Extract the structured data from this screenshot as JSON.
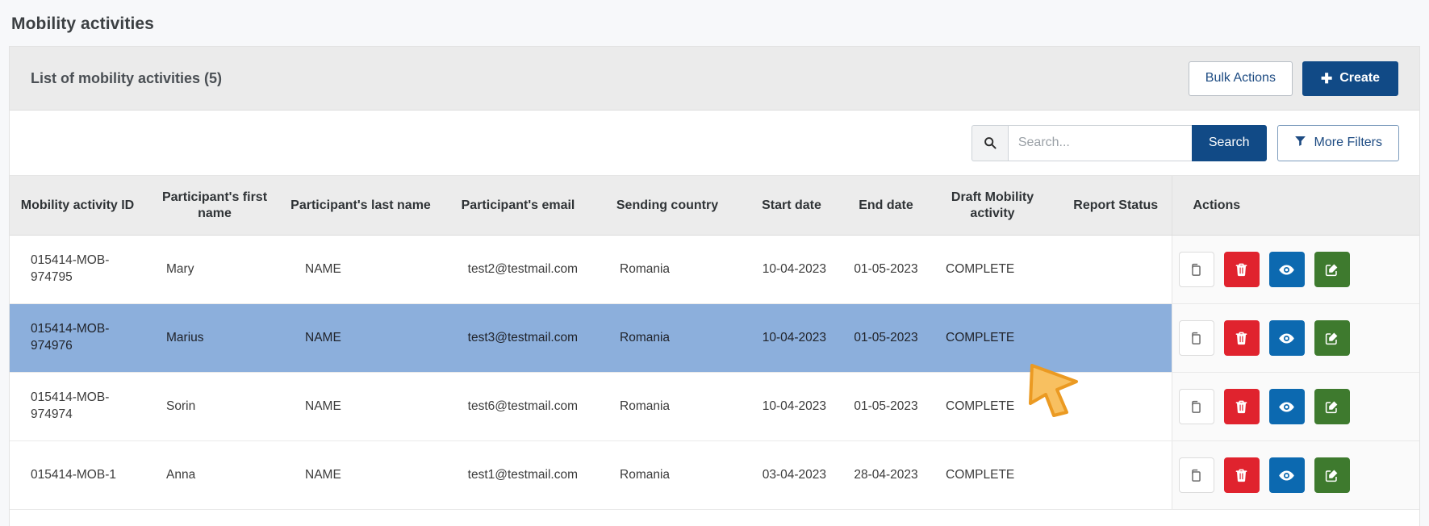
{
  "page": {
    "title": "Mobility activities"
  },
  "card": {
    "header_title": "List of mobility activities (5)",
    "bulk_actions_label": "Bulk Actions",
    "create_label": "Create",
    "create_icon": "plus-icon"
  },
  "search": {
    "icon": "search-icon",
    "placeholder": "Search...",
    "value": "",
    "search_label": "Search",
    "more_filters_label": "More Filters",
    "filter_icon": "funnel-icon"
  },
  "table": {
    "columns": [
      "Mobility activity ID",
      "Participant's first name",
      "Participant's last name",
      "Participant's email",
      "Sending country",
      "Start date",
      "End date",
      "Draft Mobility activity",
      "Report Status",
      "Actions"
    ],
    "rows": [
      {
        "id": "015414-MOB-974795",
        "first_name": "Mary",
        "last_name": "NAME",
        "email": "test2@testmail.com",
        "sending_country": "Romania",
        "start_date": "10-04-2023",
        "end_date": "01-05-2023",
        "draft_mobility_activity": "COMPLETE",
        "report_status": "",
        "selected": false
      },
      {
        "id": "015414-MOB-974976",
        "first_name": "Marius",
        "last_name": "NAME",
        "email": "test3@testmail.com",
        "sending_country": "Romania",
        "start_date": "10-04-2023",
        "end_date": "01-05-2023",
        "draft_mobility_activity": "COMPLETE",
        "report_status": "",
        "selected": true
      },
      {
        "id": "015414-MOB-974974",
        "first_name": "Sorin",
        "last_name": "NAME",
        "email": "test6@testmail.com",
        "sending_country": "Romania",
        "start_date": "10-04-2023",
        "end_date": "01-05-2023",
        "draft_mobility_activity": "COMPLETE",
        "report_status": "",
        "selected": false
      },
      {
        "id": "015414-MOB-1",
        "first_name": "Anna",
        "last_name": "NAME",
        "email": "test1@testmail.com",
        "sending_country": "Romania",
        "start_date": "03-04-2023",
        "end_date": "28-04-2023",
        "draft_mobility_activity": "COMPLETE",
        "report_status": "",
        "selected": false
      }
    ],
    "row_actions": [
      {
        "name": "copy-button",
        "icon": "copy-icon"
      },
      {
        "name": "delete-button",
        "icon": "trash-icon"
      },
      {
        "name": "view-button",
        "icon": "eye-icon"
      },
      {
        "name": "edit-button",
        "icon": "pencil-square-icon"
      }
    ]
  },
  "cursor": {
    "icon": "mouse-pointer-arrow",
    "color": "#f5b042"
  },
  "colors": {
    "brand_blue": "#114a86",
    "selected_row": "#8cafdc",
    "delete_red": "#e0232e",
    "view_blue": "#0c69b0",
    "edit_green": "#3e7a2e",
    "header_gray": "#ececec",
    "page_background": "#f7f8fa"
  }
}
